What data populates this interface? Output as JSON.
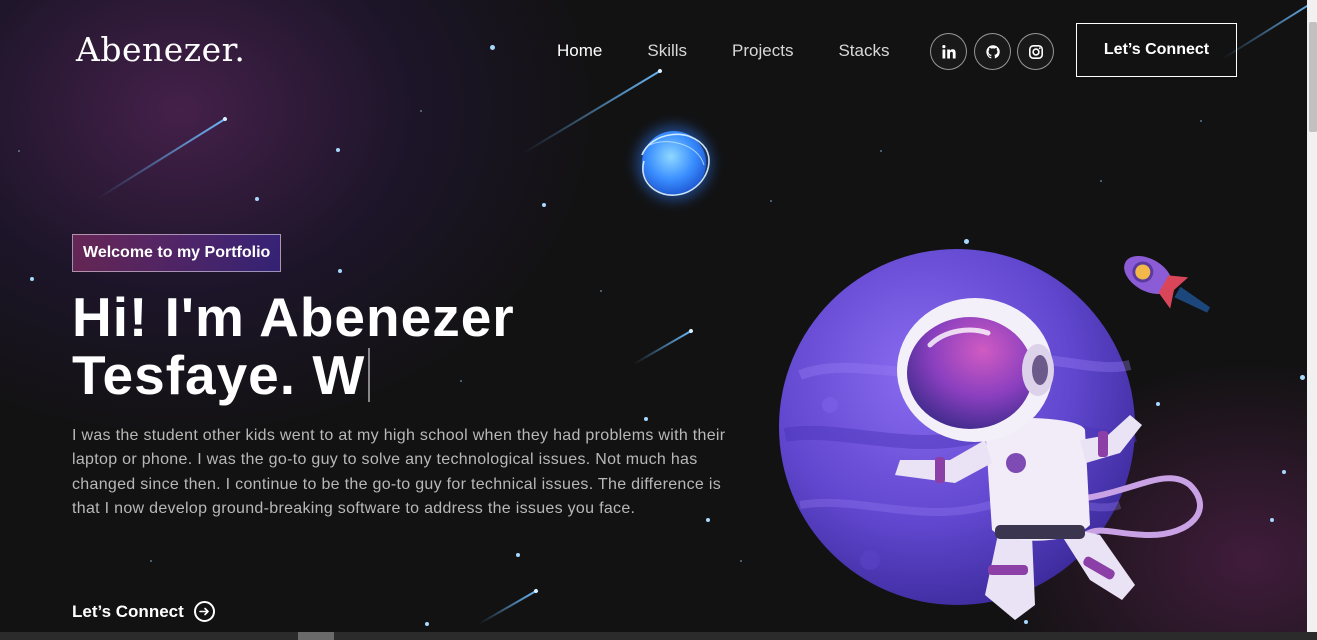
{
  "nav": {
    "logo": "Abenezer.",
    "links": [
      "Home",
      "Skills",
      "Projects",
      "Stacks"
    ],
    "active_link": "Home",
    "social_icons": [
      "linkedin-icon",
      "github-icon",
      "instagram-icon"
    ],
    "connect_label": "Let’s Connect"
  },
  "hero": {
    "tagline": "Welcome to my Portfolio",
    "headline_line1": "Hi! I'm Abenezer",
    "headline_line2": "Tesfaye. W",
    "description": "I was the student other kids went to at my high school when they had problems with their laptop or phone. I was the go-to guy to solve any technological issues. Not much has changed since then. I continue to be the go-to guy for technical issues. The difference is that I now develop ground-breaking software to address the issues you face.",
    "cta_label": "Let’s Connect"
  },
  "colors": {
    "background": "#121212",
    "accent_pink": "#aa367c",
    "accent_purple": "#4a2fbd",
    "planet": "#6b4fd6",
    "star": "#a9d8ff"
  }
}
